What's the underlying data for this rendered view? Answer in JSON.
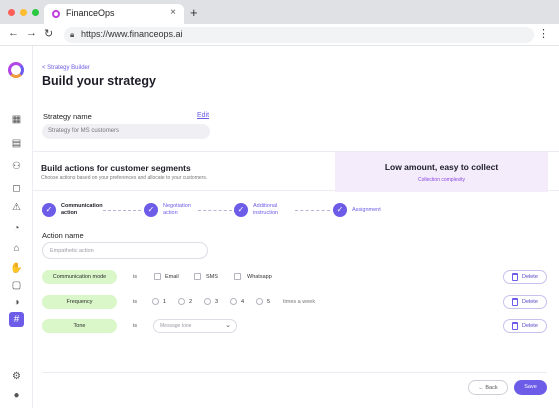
{
  "browser": {
    "tab_title": "FinanceOps",
    "tab_close": "×",
    "new_tab": "+",
    "url": "https://www.financeops.ai",
    "icons": [
      "back-arrow-icon",
      "forward-arrow-icon",
      "reload-icon",
      "lock-icon",
      "kebab-menu-icon"
    ]
  },
  "sidebar": {
    "icons": [
      "dashboard-icon",
      "document-icon",
      "users-icon",
      "chat-icon",
      "alert-icon",
      "shield-icon",
      "bank-icon",
      "handshake-icon",
      "clipboard-icon",
      "pie-chart-icon",
      "strategy-icon",
      "settings-icon",
      "notification-icon"
    ],
    "active": "strategy-icon"
  },
  "header": {
    "breadcrumb": "< Strategy Builder",
    "title": "Build your strategy"
  },
  "strategy": {
    "label": "Strategy name",
    "edit": "Edit",
    "value": "Strategy for MS customers"
  },
  "segments": {
    "title": "Build actions for customer segments",
    "subtitle": "Choose actions based on your preferences and allocate to your customers.",
    "segment_title": "Low amount, easy to collect",
    "segment_sub": "Collection complexity"
  },
  "steps": [
    {
      "line1": "Communication",
      "line2": "action",
      "status": "done"
    },
    {
      "line1": "Negotiation",
      "line2": "action",
      "status": "todo"
    },
    {
      "line1": "Additional",
      "line2": "instruction",
      "status": "todo"
    },
    {
      "line1": "Assignment",
      "line2": "",
      "status": "todo"
    }
  ],
  "action": {
    "label": "Action name",
    "placeholder": "Empathetic action"
  },
  "rows": [
    {
      "pill": "Communication mode",
      "operator": "is",
      "options": [
        "Email",
        "SMS",
        "Whatsapp"
      ],
      "delete": "Delete"
    },
    {
      "pill": "Frequency",
      "operator": "is",
      "options": [
        "1",
        "2",
        "3",
        "4",
        "5"
      ],
      "suffix": "times a week",
      "delete": "Delete"
    },
    {
      "pill": "Tone",
      "operator": "is",
      "select_placeholder": "Message tone",
      "delete": "Delete"
    }
  ],
  "footer": {
    "back": "← Back",
    "save": "Save"
  },
  "colors": {
    "accent": "#6c5ce7",
    "pill_green": "#d9f7c8",
    "segment_bg": "#f4ebfb"
  }
}
